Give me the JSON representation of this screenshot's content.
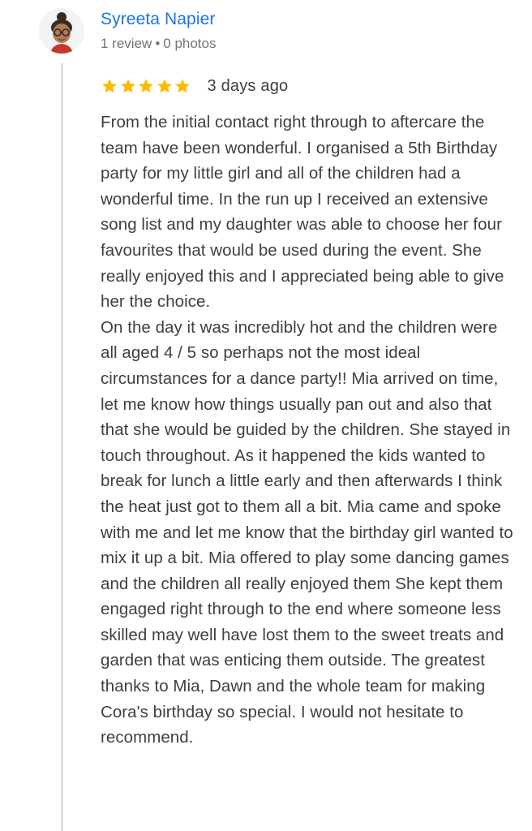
{
  "reviewer": {
    "name": "Syreeta Napier",
    "review_count": "1 review",
    "separator": "•",
    "photo_count": "0 photos",
    "avatar_icon": "bitmoji-avatar-icon"
  },
  "review": {
    "rating": 5,
    "max_rating": 5,
    "star_color": "#fbbc04",
    "date": "3 days ago",
    "paragraphs": [
      "From the initial contact right through to aftercare the team have been wonderful. I organised a 5th Birthday party for my little girl and all of the children had a wonderful time. In the run up I received an extensive song list and my daughter was able to choose her four favourites that would be used during the event. She really enjoyed this and I appreciated being able to give her the choice.",
      "On the day it was incredibly hot and the children were all aged 4 / 5 so perhaps not the most ideal circumstances for a dance party!! Mia arrived on time, let me know how things usually pan out and also that that she would be guided by the children. She stayed in touch throughout. As it happened the kids wanted to break for lunch a little early and then afterwards I think the heat just got to them all a bit. Mia came and spoke with me and let me know that the birthday girl wanted to mix it up a bit. Mia offered to play some dancing games and the children all really enjoyed them She kept them engaged right through to the end where someone less skilled may well have lost them to the sweet treats and garden that was enticing them outside. The greatest thanks to Mia, Dawn and the whole team for making Cora's birthday so special. I would not hesitate to recommend."
    ]
  },
  "colors": {
    "name_link": "#1a73e8",
    "meta_text": "#70757a",
    "body_text": "#3c4043",
    "thread_line": "#e0e0e0"
  }
}
